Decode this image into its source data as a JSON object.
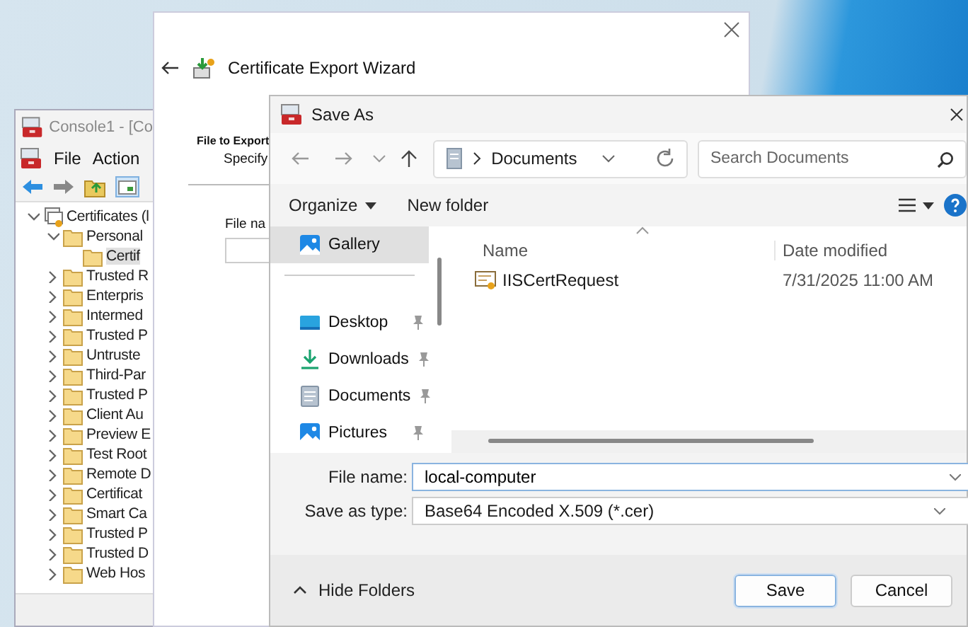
{
  "console": {
    "title": "Console1 - [Co",
    "menu": [
      "File",
      "Action"
    ],
    "tree": [
      {
        "label": "Certificates (l",
        "expanded": true,
        "selected": false,
        "children": [
          {
            "label": "Personal",
            "expanded": true,
            "selected": false,
            "children": [
              {
                "label": "Certif",
                "selected": true
              }
            ]
          },
          {
            "label": "Trusted R",
            "expanded": false,
            "selected": false
          },
          {
            "label": "Enterpris",
            "expanded": false,
            "selected": false
          },
          {
            "label": "Intermed",
            "expanded": false,
            "selected": false
          },
          {
            "label": "Trusted P",
            "expanded": false,
            "selected": false
          },
          {
            "label": "Untruste",
            "expanded": false,
            "selected": false
          },
          {
            "label": "Third-Par",
            "expanded": false,
            "selected": false
          },
          {
            "label": "Trusted P",
            "expanded": false,
            "selected": false
          },
          {
            "label": "Client Au",
            "expanded": false,
            "selected": false
          },
          {
            "label": "Preview E",
            "expanded": false,
            "selected": false
          },
          {
            "label": "Test Root",
            "expanded": false,
            "selected": false
          },
          {
            "label": "Remote D",
            "expanded": false,
            "selected": false
          },
          {
            "label": "Certificat",
            "expanded": false,
            "selected": false
          },
          {
            "label": "Smart Ca",
            "expanded": false,
            "selected": false
          },
          {
            "label": "Trusted P",
            "expanded": false,
            "selected": false
          },
          {
            "label": "Trusted D",
            "expanded": false,
            "selected": false
          },
          {
            "label": "Web Hos",
            "expanded": false,
            "selected": false
          }
        ]
      }
    ]
  },
  "wizard": {
    "title": "Certificate Export Wizard",
    "heading": "File to Export",
    "subheading": "Specify",
    "field_label": "File na"
  },
  "save_as": {
    "title": "Save As",
    "address": "Documents",
    "search": {
      "placeholder": "Search Documents"
    },
    "toolbar": [
      "Organize",
      "New folder"
    ],
    "nav_pane": [
      {
        "label": "Gallery",
        "kind": "gallery",
        "selected": true,
        "pinned": false
      },
      {
        "label": "Desktop",
        "kind": "desktop",
        "selected": false,
        "pinned": true
      },
      {
        "label": "Downloads",
        "kind": "downloads",
        "selected": false,
        "pinned": true
      },
      {
        "label": "Documents",
        "kind": "documents",
        "selected": false,
        "pinned": true
      },
      {
        "label": "Pictures",
        "kind": "pictures",
        "selected": false,
        "pinned": true
      }
    ],
    "columns": [
      "Name",
      "Date modified"
    ],
    "files": [
      {
        "name": "IISCertRequest",
        "date": "7/31/2025 11:00 AM"
      }
    ],
    "file_name": {
      "label": "File name:",
      "value": "local-computer"
    },
    "save_as_type": {
      "label": "Save as type:",
      "value": "Base64 Encoded X.509 (*.cer)"
    },
    "hide_folders": "Hide Folders",
    "buttons": [
      "Save",
      "Cancel"
    ]
  }
}
